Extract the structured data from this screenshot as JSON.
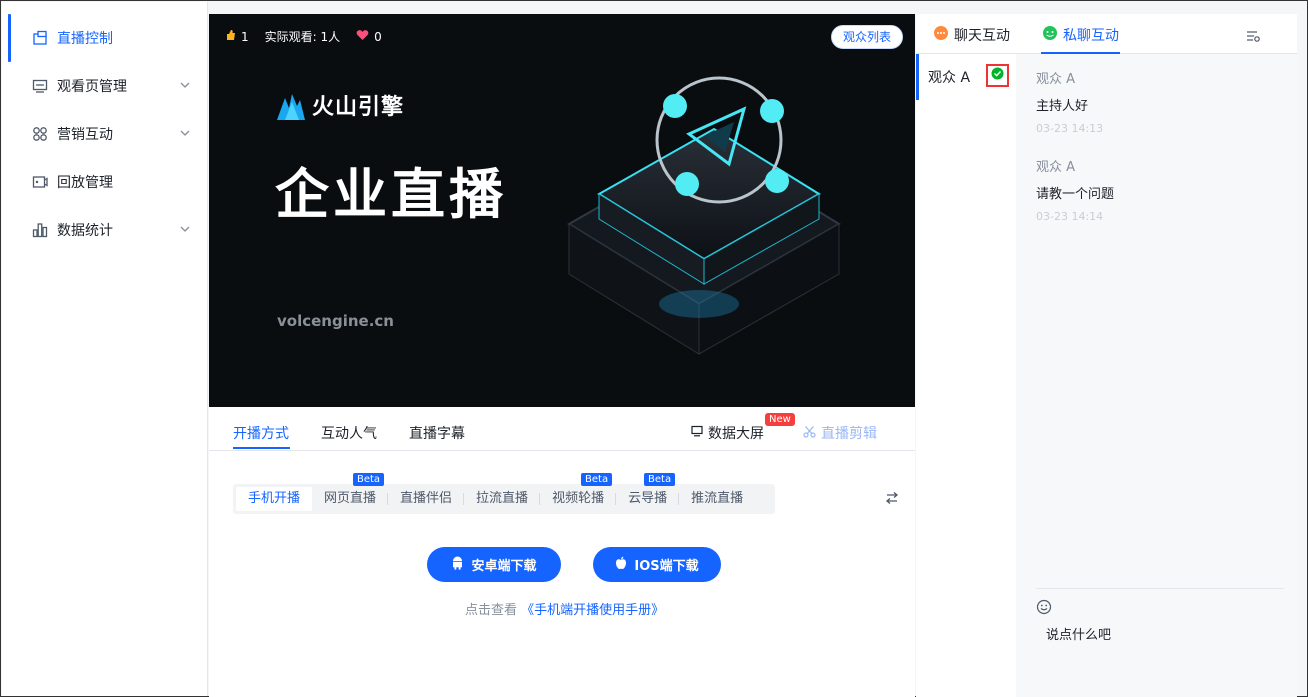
{
  "sidebar": {
    "items": [
      {
        "label": "直播控制",
        "icon": "live-control-icon",
        "active": true,
        "expandable": false
      },
      {
        "label": "观看页管理",
        "icon": "watch-page-icon",
        "active": false,
        "expandable": true
      },
      {
        "label": "营销互动",
        "icon": "marketing-icon",
        "active": false,
        "expandable": true
      },
      {
        "label": "回放管理",
        "icon": "replay-icon",
        "active": false,
        "expandable": false
      },
      {
        "label": "数据统计",
        "icon": "stats-icon",
        "active": false,
        "expandable": true
      }
    ]
  },
  "video": {
    "likes": "1",
    "viewers": "实际观看: 1人",
    "hearts": "0",
    "audience_list_button": "观众列表",
    "brand": "火山引擎",
    "headline": "企业直播",
    "domain": "volcengine.cn"
  },
  "tabs": {
    "items": [
      "开播方式",
      "互动人气",
      "直播字幕"
    ],
    "active": "开播方式",
    "big_screen": "数据大屏",
    "new_badge": "New",
    "live_clip": "直播剪辑"
  },
  "methods": {
    "items": [
      {
        "label": "手机开播",
        "active": true,
        "beta": false
      },
      {
        "label": "网页直播",
        "active": false,
        "beta": true
      },
      {
        "label": "直播伴侣",
        "active": false,
        "beta": false
      },
      {
        "label": "拉流直播",
        "active": false,
        "beta": false
      },
      {
        "label": "视频轮播",
        "active": false,
        "beta": true
      },
      {
        "label": "云导播",
        "active": false,
        "beta": true
      },
      {
        "label": "推流直播",
        "active": false,
        "beta": false
      }
    ],
    "beta_label": "Beta"
  },
  "downloads": {
    "android": "安卓端下载",
    "ios": "IOS端下载",
    "help_prefix": "点击查看",
    "help_link": "《手机端开播使用手册》"
  },
  "chat": {
    "tab_public": "聊天互动",
    "tab_private": "私聊互动",
    "active_tab": "私聊互动",
    "user": "观众 A",
    "messages": [
      {
        "name": "观众 A",
        "text": "主持人好",
        "time": "03-23 14:13"
      },
      {
        "name": "观众 A",
        "text": "请教一个问题",
        "time": "03-23 14:14"
      }
    ],
    "input_placeholder": "说点什么吧"
  },
  "colors": {
    "accent": "#1664ff",
    "new_badge": "#f53f3f",
    "online": "#00b42a"
  }
}
